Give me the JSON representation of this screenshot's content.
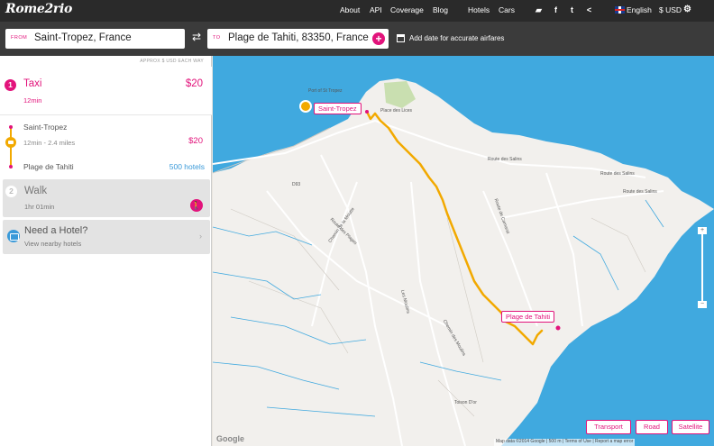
{
  "header": {
    "logo": "Rome2rio",
    "nav": [
      "About",
      "API",
      "Coverage",
      "Blog",
      "Hotels",
      "Cars"
    ],
    "icons": [
      "chat-icon",
      "facebook-icon",
      "twitter-icon",
      "share-icon"
    ],
    "language": "English",
    "currency": "$ USD"
  },
  "search": {
    "from_label": "FROM",
    "from_value": "Saint-Tropez, France",
    "to_label": "TO",
    "to_value": "Plage de Tahiti, 83350, France",
    "add_date": "Add date for accurate airfares"
  },
  "sidebar": {
    "approx": "APPROX $ USD EACH WAY",
    "segment1": {
      "num": "1",
      "title": "Taxi",
      "duration": "12min",
      "price": "$20"
    },
    "detail": {
      "from": "Saint-Tropez",
      "info": "12min - 2.4 miles",
      "price": "$20",
      "to": "Plage de Tahiti",
      "hotels": "500 hotels"
    },
    "segment2": {
      "num": "2",
      "title": "Walk",
      "duration": "1hr 01min"
    },
    "hotel": {
      "title": "Need a Hotel?",
      "sub": "View nearby hotels"
    }
  },
  "map": {
    "labels": {
      "port": "Port of St Tropez",
      "place": "Place des Lices",
      "salins1": "Route des Salins",
      "salins2": "Route des Salins",
      "salins3": "Route des Salins",
      "chemin_moulins": "Chemin de la Moutte",
      "plages": "Route des Plages",
      "moulins": "Les Moulins",
      "camarat": "Route de Camarat",
      "tahiti_road": "Chemin des Moulins",
      "toison": "Toison D'or",
      "d93": "D93"
    },
    "pin_start": "Saint-Tropez",
    "pin_end": "Plage de Tahiti",
    "buttons": {
      "transport": "Transport",
      "road": "Road",
      "satellite": "Satellite"
    },
    "google": "Google",
    "footer": "Map data ©2014 Google  |  500 m  |  Terms of Use  |  Report a map error"
  },
  "colors": {
    "accent": "#e2137b",
    "route": "#f2a900",
    "sea": "#40a9df",
    "land": "#f2f0ed"
  }
}
